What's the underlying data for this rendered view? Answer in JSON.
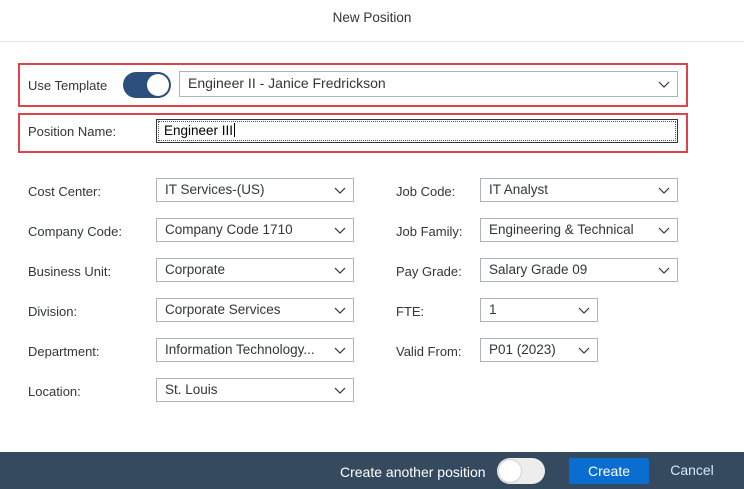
{
  "dialog": {
    "title": "New Position"
  },
  "template": {
    "label": "Use Template",
    "toggle_on": true,
    "selected": "Engineer II - Janice Fredrickson"
  },
  "position_name": {
    "label": "Position Name:",
    "value": "Engineer III"
  },
  "left_fields": [
    {
      "label": "Cost Center:",
      "value": "IT Services-(US)"
    },
    {
      "label": "Company Code:",
      "value": "Company Code 1710"
    },
    {
      "label": "Business Unit:",
      "value": "Corporate"
    },
    {
      "label": "Division:",
      "value": "Corporate Services"
    },
    {
      "label": "Department:",
      "value": "Information Technology..."
    },
    {
      "label": "Location:",
      "value": "St. Louis"
    }
  ],
  "right_fields": [
    {
      "label": "Job Code:",
      "value": "IT Analyst"
    },
    {
      "label": "Job Family:",
      "value": "Engineering & Technical"
    },
    {
      "label": "Pay Grade:",
      "value": "Salary Grade 09"
    },
    {
      "label": "FTE:",
      "value": "1"
    },
    {
      "label": "Valid From:",
      "value": "P01 (2023)"
    }
  ],
  "footer": {
    "create_another_label": "Create another position",
    "create_another_on": false,
    "create_label": "Create",
    "cancel_label": "Cancel"
  },
  "colors": {
    "highlight": "#e0424a",
    "toggle_on": "#2c4f7c",
    "footer_bg": "#354a5f",
    "primary_button": "#0a6ed1"
  }
}
